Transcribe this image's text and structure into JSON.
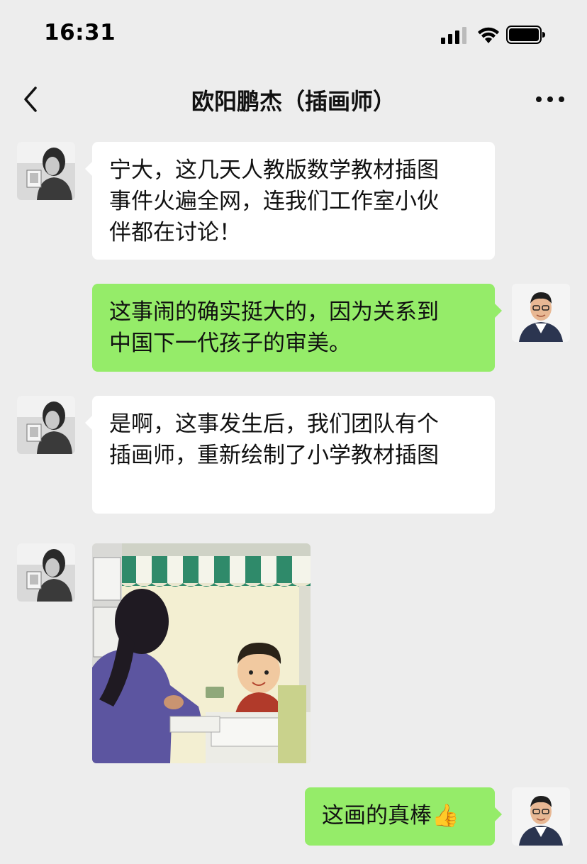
{
  "status_bar": {
    "time": "16:31"
  },
  "nav": {
    "title": "欧阳鹏杰（插画师）"
  },
  "messages": [
    {
      "side": "left",
      "lines": [
        "宁大，这几天人教版数学教材插图",
        "事件火遍全网，连我们工作室小伙",
        "伴都在讨论！"
      ]
    },
    {
      "side": "right",
      "lines": [
        "这事闹的确实挺大的，因为关系到",
        "中国下一代孩子的审美。"
      ]
    },
    {
      "side": "left",
      "lines": [
        "是啊，这事发生后，我们团队有个",
        "插画师，重新绘制了小学教材插图"
      ]
    },
    {
      "side": "left",
      "type": "image"
    },
    {
      "side": "right",
      "text": "这画的真棒",
      "emoji": "👍"
    }
  ],
  "icons": {
    "back": "chevron-left-icon",
    "more": "more-dots-icon",
    "signal": "cellular-signal-icon",
    "wifi": "wifi-icon",
    "battery": "battery-icon"
  },
  "colors": {
    "background": "#ededed",
    "bubble_self": "#95ec69",
    "bubble_other": "#ffffff"
  }
}
